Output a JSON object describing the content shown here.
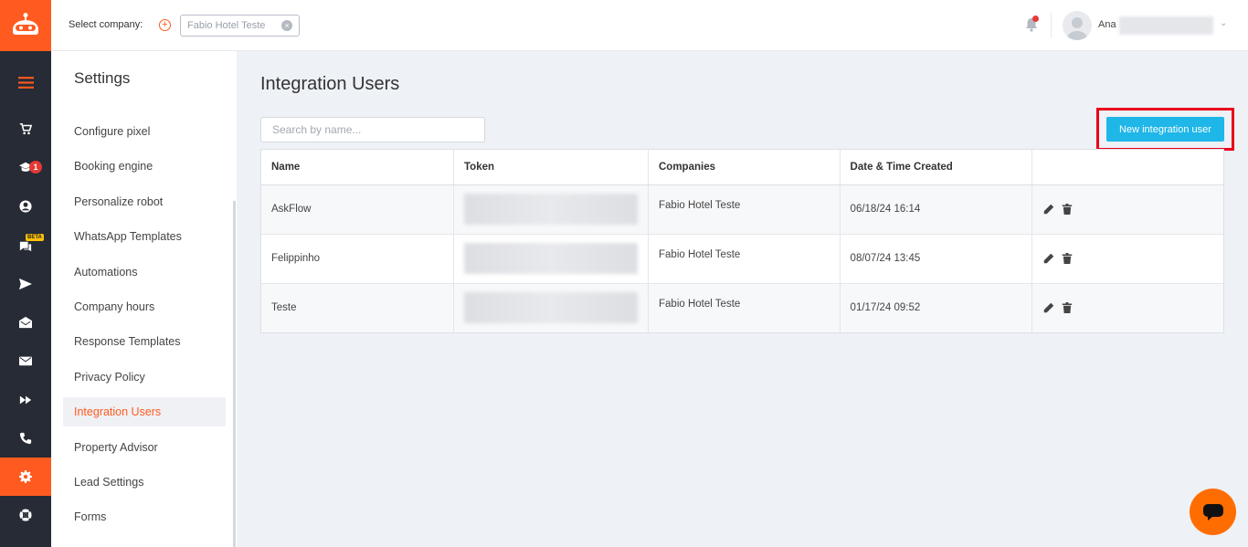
{
  "topbar": {
    "select_company_label": "Select company:",
    "selected_company": "Fabio Hotel Teste",
    "user_name": "Ana"
  },
  "rail": {
    "items": [
      {
        "icon": "menu-icon"
      },
      {
        "icon": "cart-icon"
      },
      {
        "icon": "graduation-cap-icon",
        "badge": "1"
      },
      {
        "icon": "user-circle-icon"
      },
      {
        "icon": "chat-icon",
        "badge": "BETA"
      },
      {
        "icon": "send-icon"
      },
      {
        "icon": "envelope-open-icon"
      },
      {
        "icon": "envelope-icon"
      },
      {
        "icon": "fast-forward-icon"
      },
      {
        "icon": "phone-icon"
      },
      {
        "icon": "gear-icon",
        "active": true
      },
      {
        "icon": "lifebuoy-icon"
      }
    ]
  },
  "settings": {
    "title": "Settings",
    "items": [
      "Configure pixel",
      "Booking engine",
      "Personalize robot",
      "WhatsApp Templates",
      "Automations",
      "Company hours",
      "Response Templates",
      "Privacy Policy",
      "Integration Users",
      "Property Advisor",
      "Lead Settings",
      "Forms"
    ],
    "active_item": "Integration Users"
  },
  "main": {
    "title": "Integration Users",
    "search_placeholder": "Search by name...",
    "new_button_label": "New integration user",
    "columns": [
      "Name",
      "Token",
      "Companies",
      "Date & Time Created",
      ""
    ],
    "rows": [
      {
        "name": "AskFlow",
        "company": "Fabio Hotel Teste",
        "created": "06/18/24 16:14"
      },
      {
        "name": "Felippinho",
        "company": "Fabio Hotel Teste",
        "created": "08/07/24 13:45"
      },
      {
        "name": "Teste",
        "company": "Fabio Hotel Teste",
        "created": "01/17/24 09:52"
      }
    ]
  },
  "colors": {
    "brand": "#ff5a1f",
    "rail_bg": "#262b35",
    "button": "#1fb6e8",
    "highlight_frame": "#e8001c"
  }
}
